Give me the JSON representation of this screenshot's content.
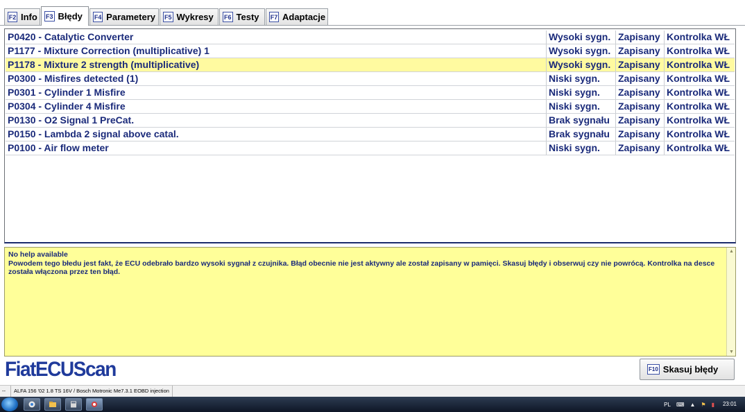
{
  "tabs": [
    {
      "key": "F2",
      "label": "Info",
      "active": false
    },
    {
      "key": "F3",
      "label": "Błędy",
      "active": true
    },
    {
      "key": "F4",
      "label": "Parametery",
      "active": false
    },
    {
      "key": "F5",
      "label": "Wykresy",
      "active": false
    },
    {
      "key": "F6",
      "label": "Testy",
      "active": false
    },
    {
      "key": "F7",
      "label": "Adaptacje",
      "active": false
    }
  ],
  "errors": [
    {
      "code": "P0420 - Catalytic Converter",
      "level": "Wysoki sygn.",
      "status": "Zapisany",
      "lamp": "Kontrolka WŁ"
    },
    {
      "code": "P1177 - Mixture Correction (multiplicative) 1",
      "level": "Wysoki sygn.",
      "status": "Zapisany",
      "lamp": "Kontrolka WŁ"
    },
    {
      "code": "P1178 - Mixture 2 strength  (multiplicative)",
      "level": "Wysoki sygn.",
      "status": "Zapisany",
      "lamp": "Kontrolka WŁ",
      "selected": true
    },
    {
      "code": "P0300 - Misfires detected (1)",
      "level": "Niski sygn.",
      "status": "Zapisany",
      "lamp": "Kontrolka WŁ"
    },
    {
      "code": "P0301 - Cylinder 1 Misfire",
      "level": "Niski sygn.",
      "status": "Zapisany",
      "lamp": "Kontrolka WŁ"
    },
    {
      "code": "P0304 - Cylinder 4 Misfire",
      "level": "Niski sygn.",
      "status": "Zapisany",
      "lamp": "Kontrolka WŁ"
    },
    {
      "code": "P0130 - O2 Signal 1 PreCat.",
      "level": "Brak sygnału",
      "status": "Zapisany",
      "lamp": "Kontrolka WŁ"
    },
    {
      "code": "P0150 - Lambda 2 signal above catal.",
      "level": "Brak sygnału",
      "status": "Zapisany",
      "lamp": "Kontrolka WŁ"
    },
    {
      "code": "P0100 - Air flow meter",
      "level": "Niski sygn.",
      "status": "Zapisany",
      "lamp": "Kontrolka WŁ"
    }
  ],
  "help": {
    "title": "No help available",
    "body": "Powodem tego błedu jest fakt, że ECU odebrało bardzo wysoki sygnał z czujnika. Błąd obecnie nie jest aktywny ale został zapisany w pamięci. Skasuj błędy i obserwuj czy nie powrócą. Kontrolka na desce została włączona przez ten błąd."
  },
  "logo": "FiatECUScan",
  "clear_button": {
    "key": "F10",
    "label": "Skasuj błędy"
  },
  "statusbar": {
    "seg1": "--",
    "vehicle": "ALFA 156 '02 1.8 TS 16V / Bosch Motronic Me7.3.1 EOBD injection"
  },
  "taskbar": {
    "lang": "PL",
    "time": "23:01"
  },
  "colors": {
    "text_blue": "#1a2a7a",
    "selected_row": "#fffaa0",
    "help_bg": "#ffff99",
    "logo_blue": "#1f3a9b"
  }
}
